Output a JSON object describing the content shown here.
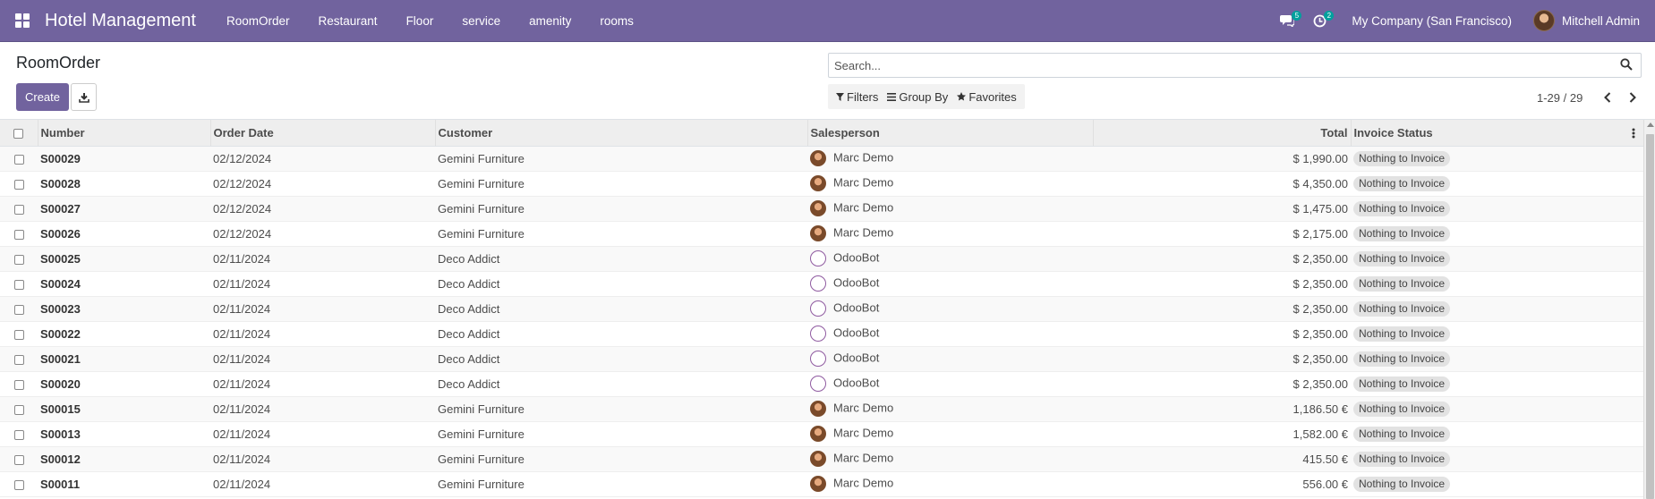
{
  "navbar": {
    "brand": "Hotel Management",
    "menu": [
      "RoomOrder",
      "Restaurant",
      "Floor",
      "service",
      "amenity",
      "rooms"
    ],
    "messages_count": "5",
    "activities_count": "2",
    "company": "My Company (San Francisco)",
    "user": "Mitchell Admin",
    "bg_color": "#71639e"
  },
  "control": {
    "title": "RoomOrder",
    "create_label": "Create",
    "search_placeholder": "Search...",
    "filters_label": "Filters",
    "groupby_label": "Group By",
    "favorites_label": "Favorites",
    "pager": "1-29 / 29"
  },
  "table": {
    "headers": {
      "number": "Number",
      "order_date": "Order Date",
      "customer": "Customer",
      "salesperson": "Salesperson",
      "total": "Total",
      "invoice_status": "Invoice Status"
    },
    "rows": [
      {
        "number": "S00029",
        "date": "02/12/2024",
        "customer": "Gemini Furniture",
        "salesperson": "Marc Demo",
        "avatar": "marc",
        "total": "$ 1,990.00",
        "status": "Nothing to Invoice"
      },
      {
        "number": "S00028",
        "date": "02/12/2024",
        "customer": "Gemini Furniture",
        "salesperson": "Marc Demo",
        "avatar": "marc",
        "total": "$ 4,350.00",
        "status": "Nothing to Invoice"
      },
      {
        "number": "S00027",
        "date": "02/12/2024",
        "customer": "Gemini Furniture",
        "salesperson": "Marc Demo",
        "avatar": "marc",
        "total": "$ 1,475.00",
        "status": "Nothing to Invoice"
      },
      {
        "number": "S00026",
        "date": "02/12/2024",
        "customer": "Gemini Furniture",
        "salesperson": "Marc Demo",
        "avatar": "marc",
        "total": "$ 2,175.00",
        "status": "Nothing to Invoice"
      },
      {
        "number": "S00025",
        "date": "02/11/2024",
        "customer": "Deco Addict",
        "salesperson": "OdooBot",
        "avatar": "bot",
        "total": "$ 2,350.00",
        "status": "Nothing to Invoice"
      },
      {
        "number": "S00024",
        "date": "02/11/2024",
        "customer": "Deco Addict",
        "salesperson": "OdooBot",
        "avatar": "bot",
        "total": "$ 2,350.00",
        "status": "Nothing to Invoice"
      },
      {
        "number": "S00023",
        "date": "02/11/2024",
        "customer": "Deco Addict",
        "salesperson": "OdooBot",
        "avatar": "bot",
        "total": "$ 2,350.00",
        "status": "Nothing to Invoice"
      },
      {
        "number": "S00022",
        "date": "02/11/2024",
        "customer": "Deco Addict",
        "salesperson": "OdooBot",
        "avatar": "bot",
        "total": "$ 2,350.00",
        "status": "Nothing to Invoice"
      },
      {
        "number": "S00021",
        "date": "02/11/2024",
        "customer": "Deco Addict",
        "salesperson": "OdooBot",
        "avatar": "bot",
        "total": "$ 2,350.00",
        "status": "Nothing to Invoice"
      },
      {
        "number": "S00020",
        "date": "02/11/2024",
        "customer": "Deco Addict",
        "salesperson": "OdooBot",
        "avatar": "bot",
        "total": "$ 2,350.00",
        "status": "Nothing to Invoice"
      },
      {
        "number": "S00015",
        "date": "02/11/2024",
        "customer": "Gemini Furniture",
        "salesperson": "Marc Demo",
        "avatar": "marc",
        "total": "1,186.50 €",
        "status": "Nothing to Invoice"
      },
      {
        "number": "S00013",
        "date": "02/11/2024",
        "customer": "Gemini Furniture",
        "salesperson": "Marc Demo",
        "avatar": "marc",
        "total": "1,582.00 €",
        "status": "Nothing to Invoice"
      },
      {
        "number": "S00012",
        "date": "02/11/2024",
        "customer": "Gemini Furniture",
        "salesperson": "Marc Demo",
        "avatar": "marc",
        "total": "415.50 €",
        "status": "Nothing to Invoice"
      },
      {
        "number": "S00011",
        "date": "02/11/2024",
        "customer": "Gemini Furniture",
        "salesperson": "Marc Demo",
        "avatar": "marc",
        "total": "556.00 €",
        "status": "Nothing to Invoice"
      }
    ]
  }
}
